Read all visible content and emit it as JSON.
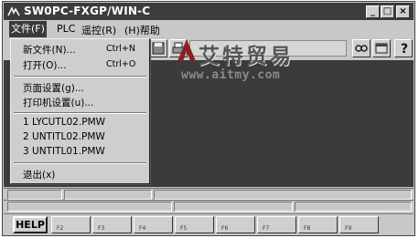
{
  "window": {
    "title": "SW0PC-FXGP/WIN-C",
    "min_label": "_",
    "max_label": "□",
    "close_label": "×"
  },
  "menubar": {
    "items": [
      {
        "label": "文件(F)"
      },
      {
        "label": "PLC"
      },
      {
        "label": "遥控(R)"
      },
      {
        "label": "(H)帮助"
      }
    ]
  },
  "file_menu": {
    "items": [
      {
        "label": "新文件(N)...",
        "shortcut": "Ctrl+N"
      },
      {
        "label": "打开(O)...",
        "shortcut": "Ctrl+O"
      },
      {
        "label": "页面设置(g)...",
        "shortcut": ""
      },
      {
        "label": "打印机设置(u)...",
        "shortcut": ""
      },
      {
        "label": "1 LYCUTL02.PMW",
        "shortcut": ""
      },
      {
        "label": "2 UNTITL02.PMW",
        "shortcut": ""
      },
      {
        "label": "3 UNTITL01.PMW",
        "shortcut": ""
      },
      {
        "label": "退出(x)",
        "shortcut": ""
      }
    ]
  },
  "toolbar": {
    "icons": [
      "save-icon",
      "print-icon",
      "find-icon",
      "window-icon",
      "help-icon"
    ]
  },
  "watermark": {
    "brand": "艾特贸易",
    "url": "www.aitmy.com"
  },
  "fkeys": {
    "help_label": "HELP",
    "keys": [
      "F2",
      "F3",
      "F4",
      "F5",
      "F6",
      "F7",
      "F8",
      "F9"
    ]
  },
  "colors": {
    "titlebar": "#3c3c3c",
    "workspace": "#3b3b3b",
    "face": "#c8c8c8"
  }
}
